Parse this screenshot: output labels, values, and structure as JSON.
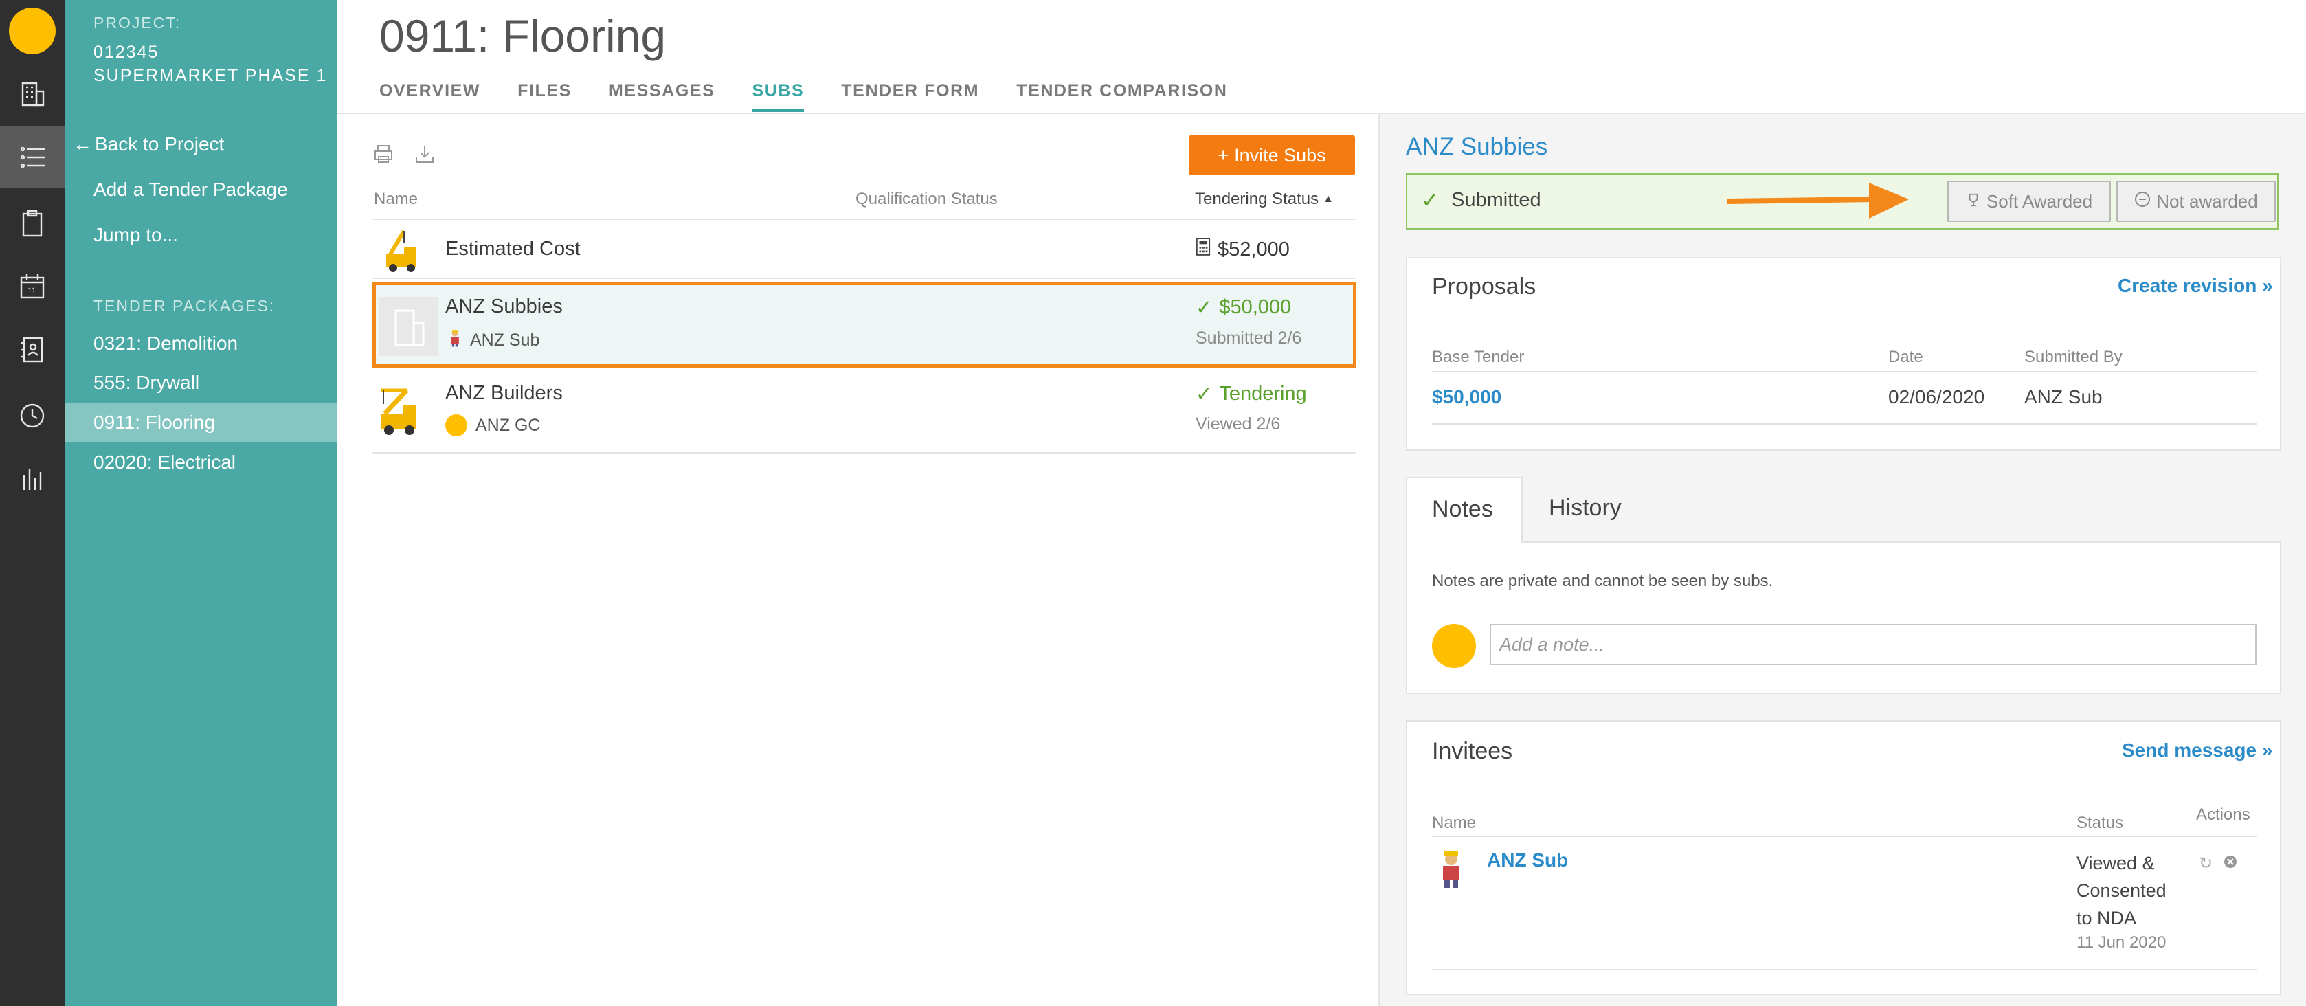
{
  "rail": {
    "items": [
      "building-icon",
      "list-icon",
      "clipboard-icon",
      "calendar-icon",
      "contacts-icon",
      "clock-icon",
      "bar-chart-icon"
    ],
    "calendar_day": "11"
  },
  "project": {
    "label": "PROJECT:",
    "id": "012345",
    "name": "SUPERMARKET PHASE 1"
  },
  "sidebar": {
    "back": "Back to Project",
    "add_package": "Add a Tender Package",
    "jump": "Jump to...",
    "packages_label": "TENDER PACKAGES:",
    "packages": [
      {
        "label": "0321: Demolition"
      },
      {
        "label": "555: Drywall"
      },
      {
        "label": "0911: Flooring",
        "active": true
      },
      {
        "label": "02020: Electrical"
      }
    ]
  },
  "page": {
    "title": "0911: Flooring",
    "tabs": [
      "OVERVIEW",
      "FILES",
      "MESSAGES",
      "SUBS",
      "TENDER FORM",
      "TENDER COMPARISON"
    ],
    "active_tab": "SUBS"
  },
  "subs_list": {
    "invite_label": "Invite Subs",
    "columns": {
      "name": "Name",
      "qualification": "Qualification Status",
      "tendering": "Tendering Status"
    },
    "rows": [
      {
        "name": "Estimated Cost",
        "value": "$52,000"
      },
      {
        "name": "ANZ Subbies",
        "contact": "ANZ Sub",
        "value": "$50,000",
        "status": "Submitted 2/6",
        "selected": true
      },
      {
        "name": "ANZ Builders",
        "contact": "ANZ GC",
        "value": "Tendering",
        "status": "Viewed 2/6"
      }
    ]
  },
  "detail": {
    "title": "ANZ Subbies",
    "status": "Submitted",
    "soft_awarded": "Soft Awarded",
    "not_awarded": "Not awarded",
    "accent_arrow_color": "#f4891b",
    "proposals": {
      "title": "Proposals",
      "create_revision": "Create revision »",
      "headers": [
        "Base Tender",
        "Date",
        "Submitted By"
      ],
      "row": {
        "base": "$50,000",
        "date": "02/06/2020",
        "by": "ANZ Sub"
      }
    },
    "notes": {
      "tab_notes": "Notes",
      "tab_history": "History",
      "privacy": "Notes are private and cannot be seen by subs.",
      "placeholder": "Add a note..."
    },
    "invitees": {
      "title": "Invitees",
      "send_message": "Send message »",
      "headers": {
        "name": "Name",
        "status": "Status",
        "actions": "Actions"
      },
      "row": {
        "name": "ANZ Sub",
        "status_lines": [
          "Viewed &",
          "Consented",
          "to NDA"
        ],
        "date": "11 Jun 2020"
      }
    }
  },
  "colors": {
    "teal": "#4aa9a4",
    "orange": "#f47b0f",
    "link_blue": "#2a8bc8",
    "green": "#5aa02c"
  }
}
